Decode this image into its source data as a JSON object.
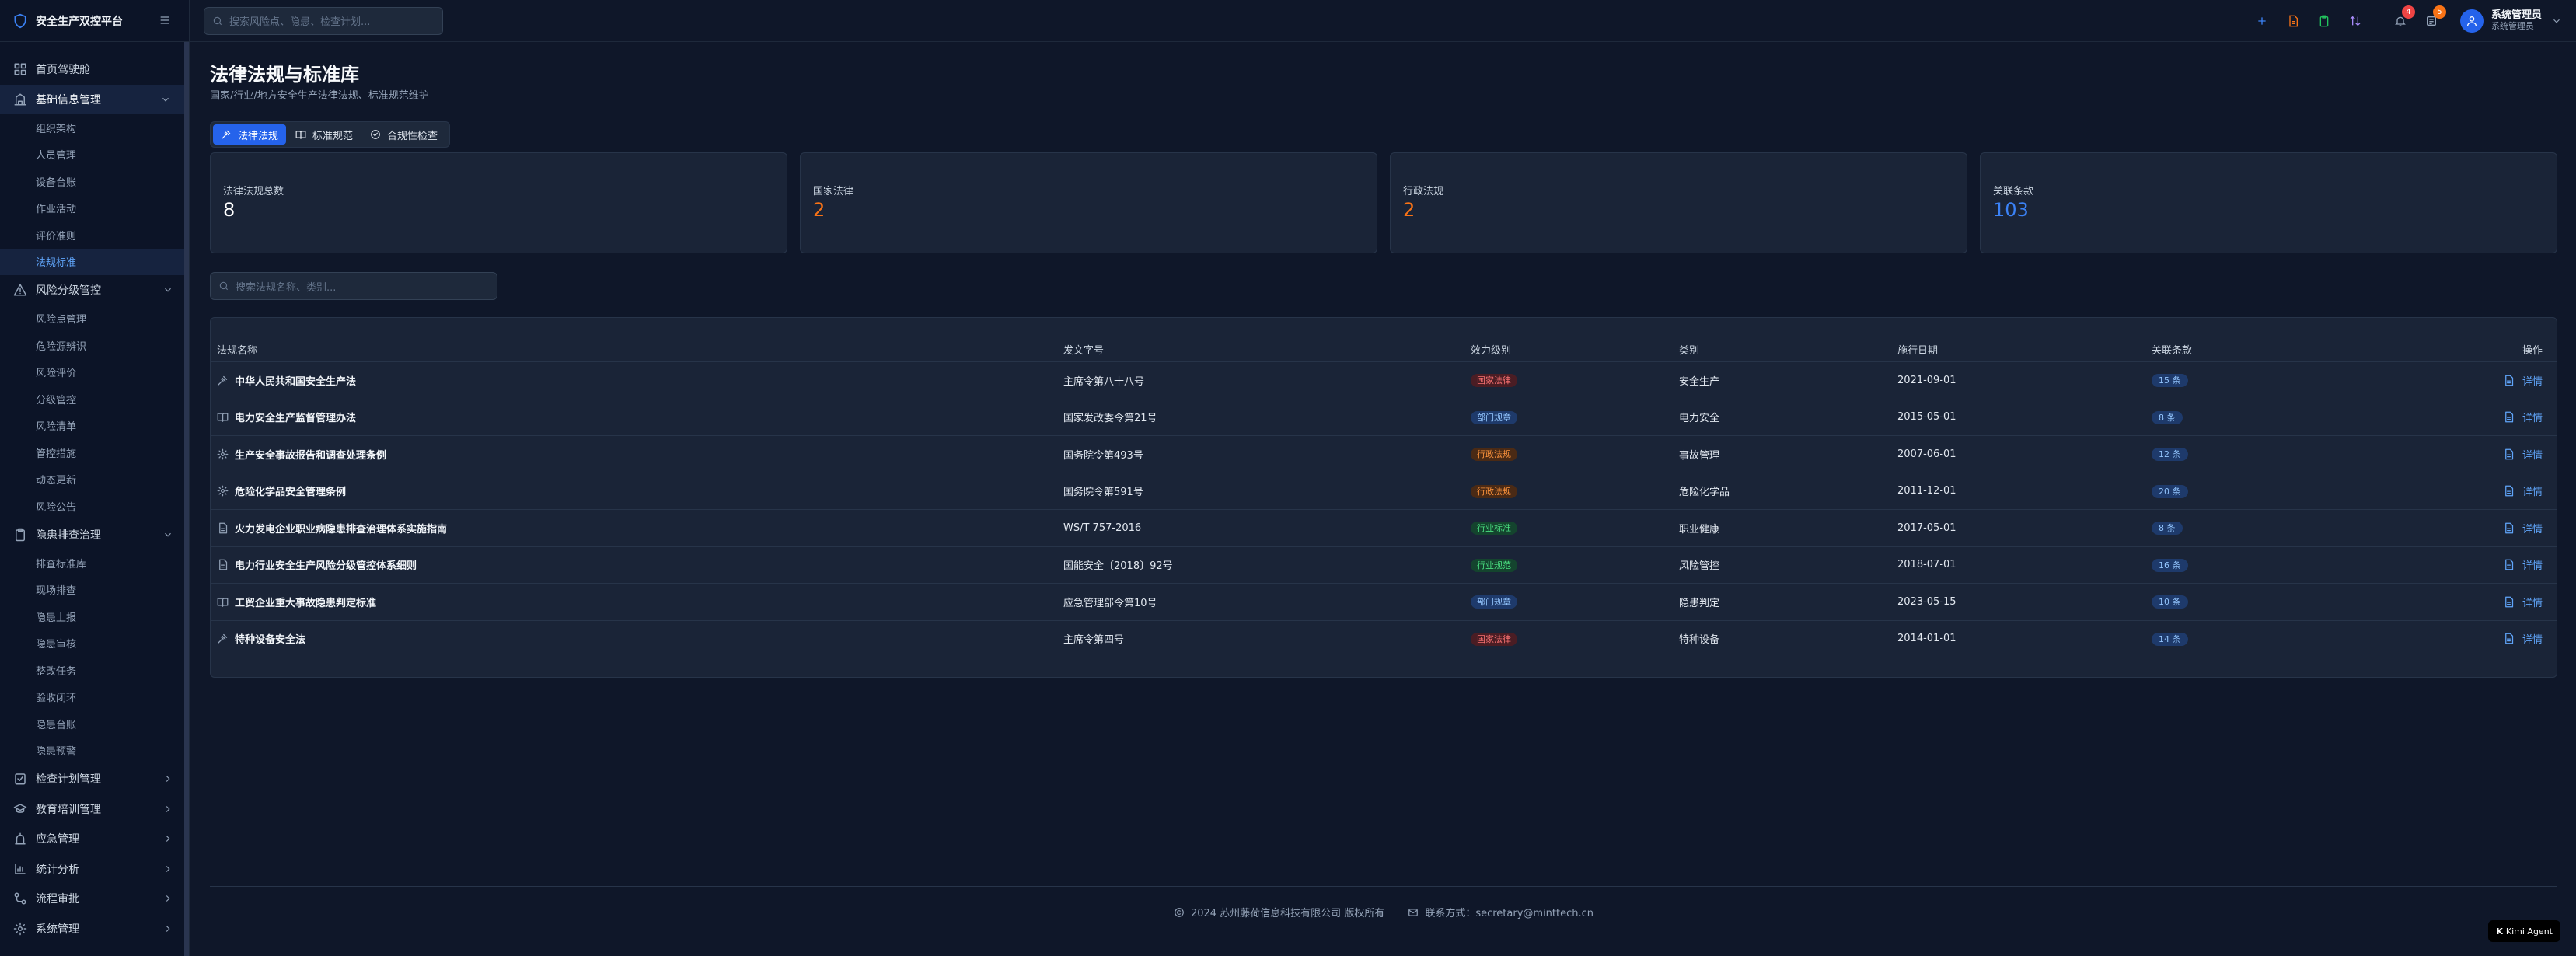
{
  "app": {
    "title": "安全生产双控平台"
  },
  "search": {
    "global_placeholder": "搜索风险点、隐患、检查计划...",
    "list_placeholder": "搜索法规名称、类别..."
  },
  "sidebar": {
    "items": [
      {
        "label": "首页驾驶舱",
        "icon": "dashboard-icon"
      },
      {
        "label": "基础信息管理",
        "icon": "database-icon",
        "expanded": true,
        "children": [
          "组织架构",
          "人员管理",
          "设备台账",
          "作业活动",
          "评价准则",
          "法规标准"
        ],
        "active_child": "法规标准"
      },
      {
        "label": "风险分级管控",
        "icon": "warning-icon",
        "expanded": true,
        "children": [
          "风险点管理",
          "危险源辨识",
          "风险评价",
          "分级管控",
          "风险清单",
          "管控措施",
          "动态更新",
          "风险公告"
        ]
      },
      {
        "label": "隐患排查治理",
        "icon": "clipboard-icon",
        "expanded": true,
        "children": [
          "排查标准库",
          "现场排查",
          "隐患上报",
          "隐患审核",
          "整改任务",
          "验收闭环",
          "隐患台账",
          "隐患预警"
        ]
      },
      {
        "label": "检查计划管理",
        "icon": "checklist-icon",
        "expanded": false
      },
      {
        "label": "教育培训管理",
        "icon": "graduation-cap-icon",
        "expanded": false
      },
      {
        "label": "应急管理",
        "icon": "siren-icon",
        "expanded": false
      },
      {
        "label": "统计分析",
        "icon": "bar-chart-icon",
        "expanded": false
      },
      {
        "label": "流程审批",
        "icon": "workflow-icon",
        "expanded": false
      },
      {
        "label": "系统管理",
        "icon": "gear-icon",
        "expanded": false
      }
    ]
  },
  "topbar": {
    "icons": [
      "plus-icon",
      "file-icon",
      "clipboard-icon",
      "transfer-icon",
      "bell-icon",
      "tasks-icon"
    ],
    "bell_badge": "4",
    "tasks_badge": "5",
    "user_name": "系统管理员",
    "user_role": "系统管理员"
  },
  "page": {
    "title": "法律法规与标准库",
    "subtitle": "国家/行业/地方安全生产法律法规、标准规范维护"
  },
  "tabs": [
    {
      "label": "法律法规",
      "icon": "gavel-icon",
      "active": true
    },
    {
      "label": "标准规范",
      "icon": "book-icon",
      "active": false
    },
    {
      "label": "合规性检查",
      "icon": "check-circle-icon",
      "active": false
    }
  ],
  "stats": [
    {
      "label": "法律法规总数",
      "value": "8",
      "color": "#ffffff"
    },
    {
      "label": "国家法律",
      "value": "2",
      "color": "#f97316"
    },
    {
      "label": "行政法规",
      "value": "2",
      "color": "#f97316"
    },
    {
      "label": "关联条款",
      "value": "103",
      "color": "#3b82f6"
    }
  ],
  "table": {
    "headers": {
      "name": "法规名称",
      "doc": "发文字号",
      "level": "效力级别",
      "category": "类别",
      "date": "施行日期",
      "count": "关联条款",
      "op": "操作"
    },
    "rows": [
      {
        "icon": "gavel-icon",
        "name": "中华人民共和国安全生产法",
        "doc": "主席令第八十八号",
        "level": "国家法律",
        "level_color": "red",
        "category": "安全生产",
        "date": "2021-09-01",
        "count": "15 条",
        "op": "详情"
      },
      {
        "icon": "book-icon",
        "name": "电力安全生产监督管理办法",
        "doc": "国家发改委令第21号",
        "level": "部门规章",
        "level_color": "blue",
        "category": "电力安全",
        "date": "2015-05-01",
        "count": "8 条",
        "op": "详情"
      },
      {
        "icon": "gear-icon",
        "name": "生产安全事故报告和调查处理条例",
        "doc": "国务院令第493号",
        "level": "行政法规",
        "level_color": "orange",
        "category": "事故管理",
        "date": "2007-06-01",
        "count": "12 条",
        "op": "详情"
      },
      {
        "icon": "gear-icon",
        "name": "危险化学品安全管理条例",
        "doc": "国务院令第591号",
        "level": "行政法规",
        "level_color": "orange",
        "category": "危险化学品",
        "date": "2011-12-01",
        "count": "20 条",
        "op": "详情"
      },
      {
        "icon": "document-icon",
        "name": "火力发电企业职业病隐患排查治理体系实施指南",
        "doc": "WS/T 757-2016",
        "level": "行业标准",
        "level_color": "green",
        "category": "职业健康",
        "date": "2017-05-01",
        "count": "8 条",
        "op": "详情"
      },
      {
        "icon": "document-icon",
        "name": "电力行业安全生产风险分级管控体系细则",
        "doc": "国能安全〔2018〕92号",
        "level": "行业规范",
        "level_color": "green",
        "category": "风险管控",
        "date": "2018-07-01",
        "count": "16 条",
        "op": "详情"
      },
      {
        "icon": "book-icon",
        "name": "工贸企业重大事故隐患判定标准",
        "doc": "应急管理部令第10号",
        "level": "部门规章",
        "level_color": "blue",
        "category": "隐患判定",
        "date": "2023-05-15",
        "count": "10 条",
        "op": "详情"
      },
      {
        "icon": "gavel-icon",
        "name": "特种设备安全法",
        "doc": "主席令第四号",
        "level": "国家法律",
        "level_color": "red",
        "category": "特种设备",
        "date": "2014-01-01",
        "count": "14 条",
        "op": "详情"
      }
    ]
  },
  "footer": {
    "copyright": "2024 苏州藤荷信息科技有限公司 版权所有",
    "contact": "联系方式：secretary@minttech.cn"
  },
  "kimi": {
    "label": "Kimi Agent"
  },
  "colors": {
    "accent": "#2563eb",
    "background": "#0f1729",
    "card": "#1a2437",
    "red": "#ef4444",
    "orange": "#f97316",
    "green": "#22c55e",
    "blue": "#3b82f6"
  }
}
